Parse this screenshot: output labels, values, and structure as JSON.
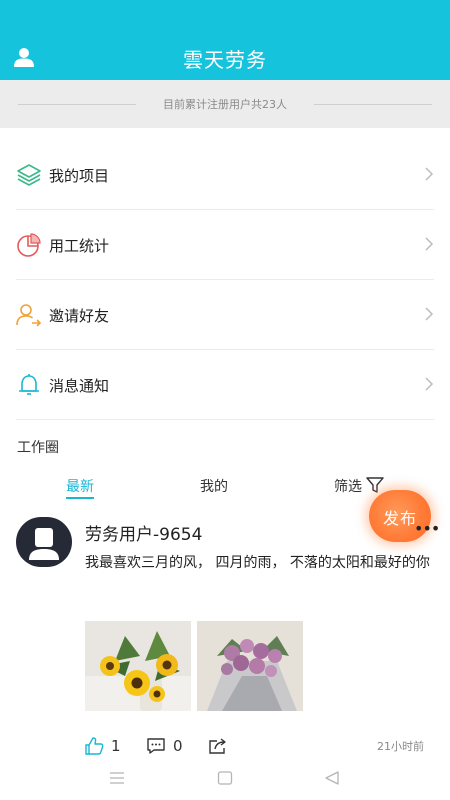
{
  "header": {
    "title": "雲天劳务",
    "user_icon": "user-icon"
  },
  "notice": {
    "text": "目前累计注册用户共23人"
  },
  "menu": {
    "items": [
      {
        "label": "我的项目",
        "icon": "layers-icon"
      },
      {
        "label": "用工统计",
        "icon": "pie-chart-icon"
      },
      {
        "label": "邀请好友",
        "icon": "invite-user-icon"
      },
      {
        "label": "消息通知",
        "icon": "bell-icon"
      }
    ]
  },
  "work_circle": {
    "title": "工作圈",
    "tabs": [
      {
        "label": "最新",
        "active": true
      },
      {
        "label": "我的",
        "active": false
      },
      {
        "label": "筛选",
        "active": false
      }
    ],
    "publish_label": "发布"
  },
  "post": {
    "author": "劳务用户-9654",
    "more": "•••",
    "content": "我最喜欢三月的风， 四月的雨， 不落的太阳和最好的你",
    "likes": "1",
    "comments": "0",
    "time": "21小时前"
  },
  "colors": {
    "header_bg": "#16c3dd",
    "accent": "#18b7d4",
    "fab": "#ff7a36"
  }
}
